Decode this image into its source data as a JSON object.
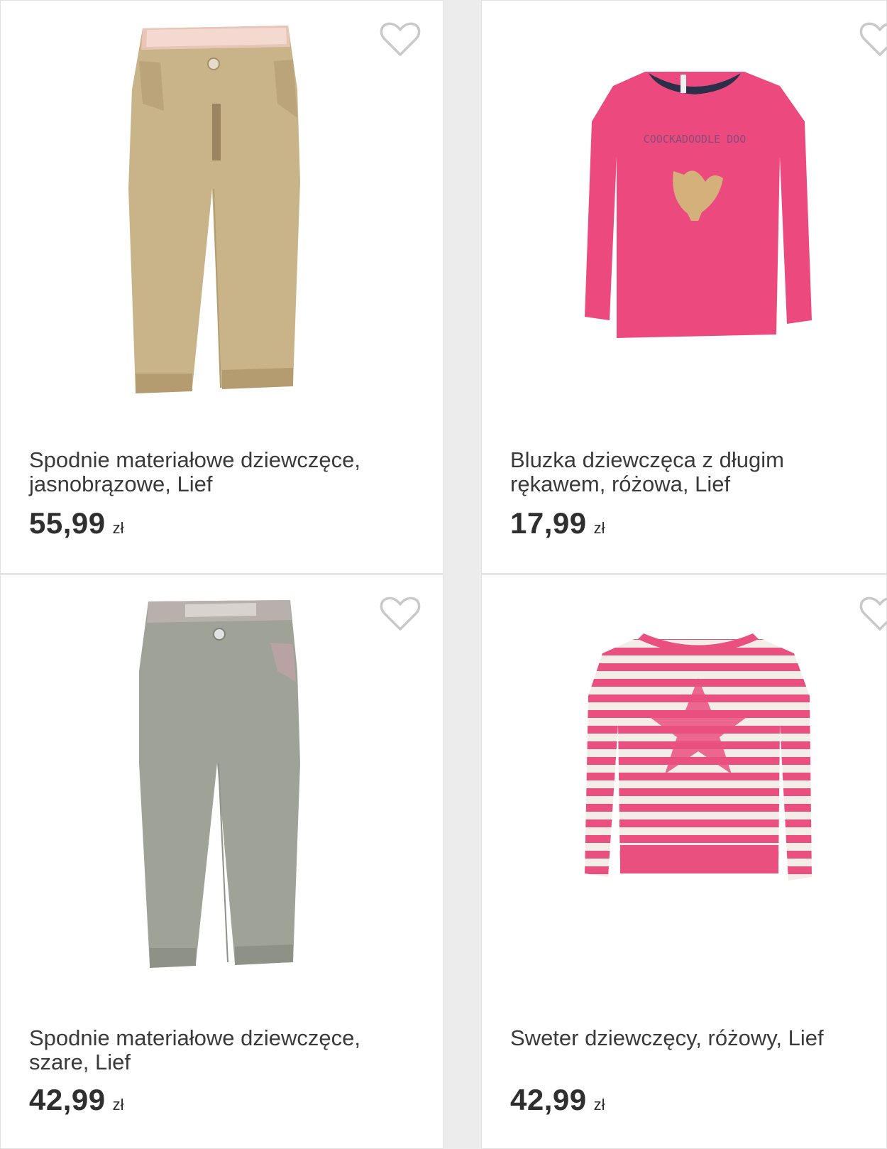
{
  "products": [
    {
      "title": "Spodnie materiałowe dziewczęce, jasnobrązowe, Lief",
      "price": "55,99",
      "currency": "zł",
      "image": "beige-pants",
      "favorite_icon": "heart-outline-icon"
    },
    {
      "title": "Bluzka dziewczęca z długim rękawem, różowa, Lief",
      "price": "17,99",
      "currency": "zł",
      "image": "pink-long-sleeve-shirt",
      "image_print": "COOCKADOODLE DOO",
      "favorite_icon": "heart-outline-icon"
    },
    {
      "title": "Spodnie materiałowe dziewczęce, szare, Lief",
      "price": "42,99",
      "currency": "zł",
      "image": "grey-pants",
      "favorite_icon": "heart-outline-icon"
    },
    {
      "title": "Sweter dziewczęcy, różowy, Lief",
      "price": "42,99",
      "currency": "zł",
      "image": "pink-striped-sweater",
      "favorite_icon": "heart-outline-icon"
    }
  ],
  "colors": {
    "page_bg": "#ececec",
    "card_bg": "#ffffff",
    "heart_outline": "#c9c9c9",
    "text": "#3a3a3a"
  }
}
